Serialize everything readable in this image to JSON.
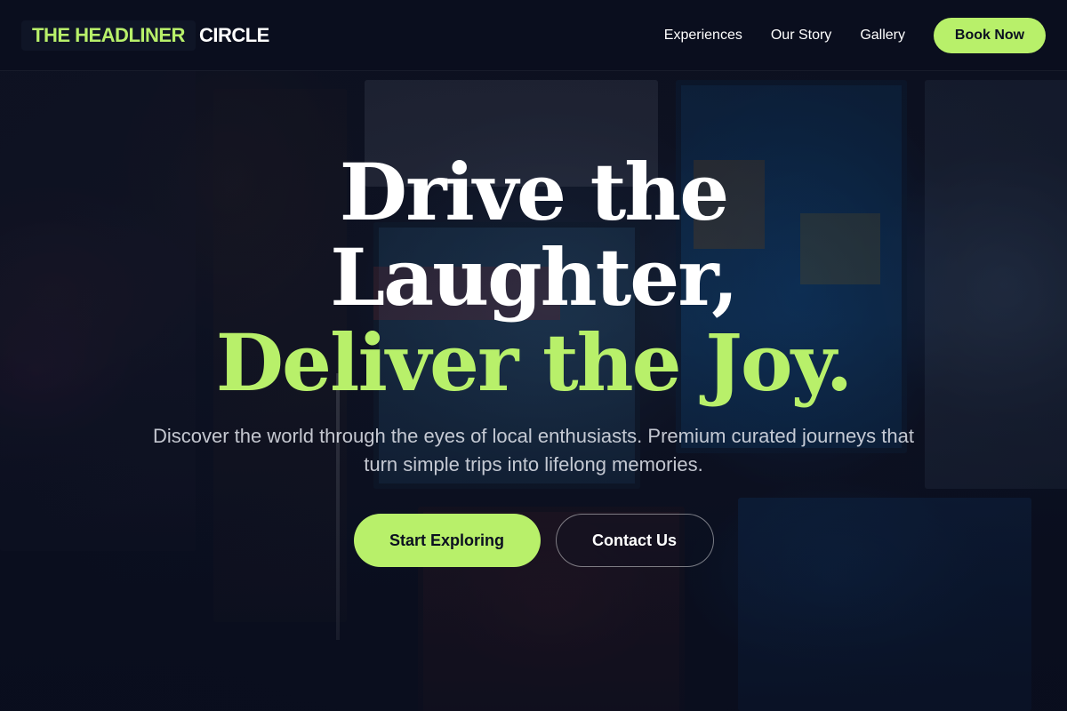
{
  "brand": {
    "primary": "THE HEADLINER",
    "secondary": "CIRCLE"
  },
  "nav": {
    "links": [
      {
        "label": "Experiences"
      },
      {
        "label": "Our Story"
      },
      {
        "label": "Gallery"
      }
    ],
    "cta_label": "Book Now"
  },
  "hero": {
    "headline_line1": "Drive the",
    "headline_line2": "Laughter,",
    "headline_line3": "Deliver the Joy.",
    "subtitle": "Discover the world through the eyes of local enthusiasts. Premium curated journeys that turn simple trips into lifelong memories.",
    "primary_cta": "Start Exploring",
    "secondary_cta": "Contact Us"
  },
  "colors": {
    "accent": "#b8f06a",
    "background": "#0b1020",
    "text": "#ffffff"
  }
}
